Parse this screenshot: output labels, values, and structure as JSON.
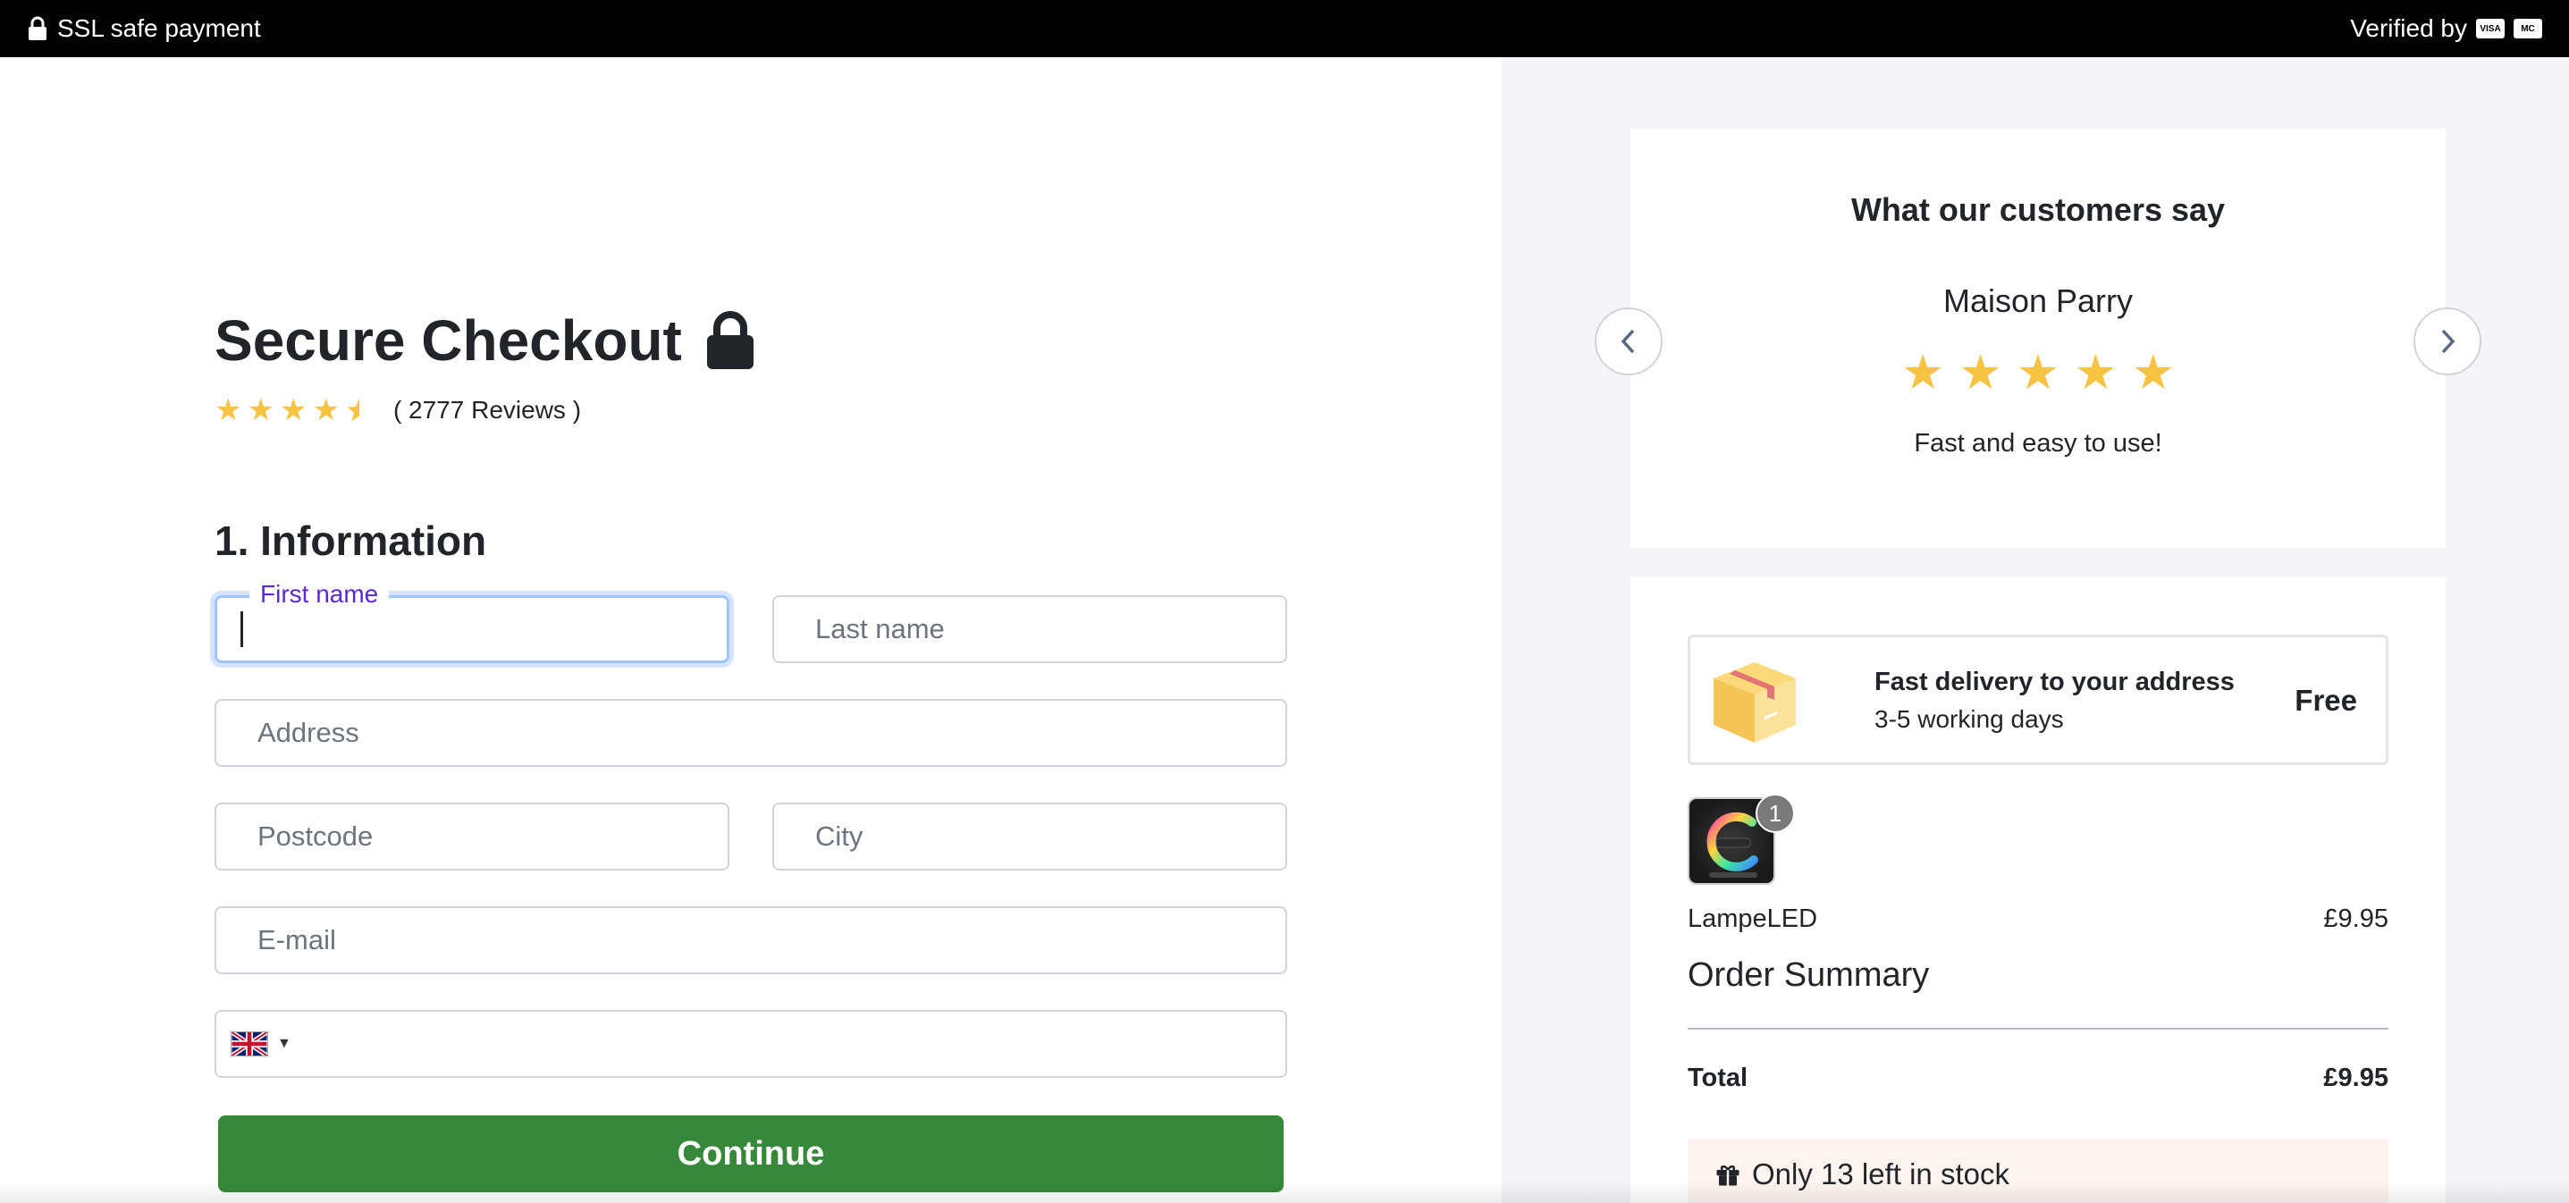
{
  "topbar": {
    "left_text": "SSL safe payment",
    "right_text": "Verified by",
    "card1": "VISA",
    "card2": "MC"
  },
  "checkout": {
    "title": "Secure Checkout",
    "rating": 4.5,
    "reviews_text": "( 2777 Reviews )",
    "section_title": "1. Information",
    "first_name_label": "First name",
    "last_name_placeholder": "Last name",
    "address_placeholder": "Address",
    "postcode_placeholder": "Postcode",
    "city_placeholder": "City",
    "email_placeholder": "E-mail",
    "continue_label": "Continue"
  },
  "testimonial": {
    "heading": "What our customers say",
    "name": "Maison Parry",
    "stars": 5,
    "quote": "Fast and easy to use!"
  },
  "order": {
    "delivery_title": "Fast delivery to your address",
    "delivery_sub": "3-5 working days",
    "delivery_price": "Free",
    "item_qty": "1",
    "item_name": "LampeLED",
    "item_price": "£9.95",
    "summary_title": "Order Summary",
    "total_label": "Total",
    "total_value": "£9.95",
    "stock_text": "Only 13 left in stock"
  },
  "colors": {
    "accent_green": "#37883a",
    "star": "#f6c343",
    "focus_label": "#5b28d6"
  }
}
